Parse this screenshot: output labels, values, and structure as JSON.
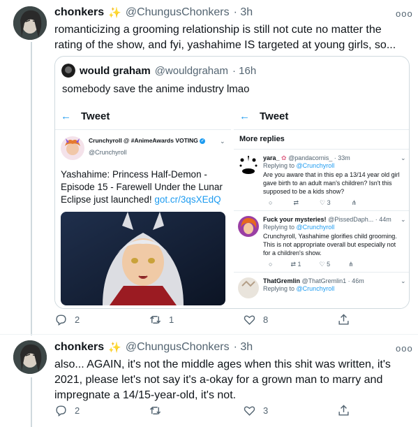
{
  "tweet1": {
    "name": "chonkers",
    "emoji": "✨",
    "handle": "@ChungusChonkers",
    "time": "· 3h",
    "text": "romanticizing a grooming relationship is still not cute no matter the rating of the show, and fyi, yashahime IS targeted at young girls, so...",
    "quote": {
      "name": "would graham",
      "handle": "@wouldgraham",
      "time": "· 16h",
      "text": "somebody save the anime industry lmao",
      "left_shot": {
        "header": "Tweet",
        "author": "Crunchyroll @ #AnimeAwards VOTING",
        "handle": "@Crunchyroll",
        "text": "Yashahime: Princess Half-Demon - Episode 15 - Farewell Under the Lunar Eclipse just launched!",
        "link": "got.cr/3qsXEdQ"
      },
      "right_shot": {
        "header": "Tweet",
        "section": "More replies",
        "replies": [
          {
            "name": "yara_",
            "handle": "@pandacornis_ · 33m",
            "replying": "Replying to",
            "to": "@Crunchyroll",
            "text": "Are you aware that in this ep a 13/14 year old girl gave birth to an adult man's children? Isn't this supposed to be a kids show?",
            "retweets": "",
            "likes": "3"
          },
          {
            "name": "Fuck your mysteries!",
            "handle": "@PissedDaph... · 44m",
            "replying": "Replying to",
            "to": "@Crunchyroll",
            "text": "Crunchyroll, Yashahime glorifies child grooming. This is not appropriate overall but especially not for a children's show.",
            "retweets": "1",
            "likes": "5"
          },
          {
            "name": "ThatGremlin",
            "handle": "@ThatGremlin1 · 46m",
            "replying": "Replying to",
            "to": "@Crunchyroll",
            "text": "",
            "retweets": "",
            "likes": ""
          }
        ]
      }
    },
    "replies": "2",
    "retweets": "1",
    "likes": "8"
  },
  "tweet2": {
    "name": "chonkers",
    "emoji": "✨",
    "handle": "@ChungusChonkers",
    "time": "· 3h",
    "text": "also... AGAIN, it's not the middle ages when this shit was written, it's 2021, please let's not say it's a-okay for a grown man to marry and impregnate a 14/15-year-old, it's not.",
    "replies": "2",
    "retweets": "",
    "likes": "3"
  },
  "more_icon": "ooo",
  "colors": {
    "accent": "#1d9bf0",
    "text": "#0f1419",
    "muted": "#536471",
    "border": "#cfd9de"
  }
}
